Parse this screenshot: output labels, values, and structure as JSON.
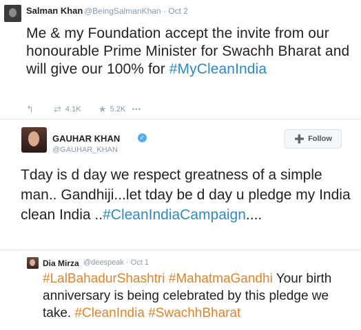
{
  "tweet1": {
    "name": "Salman Khan",
    "handle": "@BeingSalmanKhan · Oct 2",
    "text": "Me & my Foundation accept the invite from our honourable Prime Minister for Swachh Bharat and will give our 100% for ",
    "hashtag": "#MyCleanIndia",
    "retweets": "4.1K",
    "favorites": "5.2K",
    "more": "•••"
  },
  "tweet2": {
    "name": "GAUHAR KHAN",
    "handle": "@GAUHAR_KHAN",
    "follow_label": "Follow",
    "text": "Tday is d day we respect greatness of a simple man.. Gandhiji...let tday be d day u pledge my India clean India ..",
    "hashtag": "#CleanIndiaCampaign",
    "suffix": "...."
  },
  "tweet3": {
    "name": "Dia Mirza",
    "handle": "@deespeak · Oct 1",
    "hashtag1": "#LalBahadurShashtri",
    "hashtag2": "#MahatmaGandhi",
    "text": " Your birth anniversary is being celebrated by this pledge we take. ",
    "hashtag3": "#CleanIndia",
    "hashtag4": "#SwachhBharat"
  },
  "colors": {
    "link_blue": "#2d89bf",
    "hashtag_orange": "#e0842a",
    "verified_blue": "#55acee",
    "muted": "#8899a6"
  }
}
